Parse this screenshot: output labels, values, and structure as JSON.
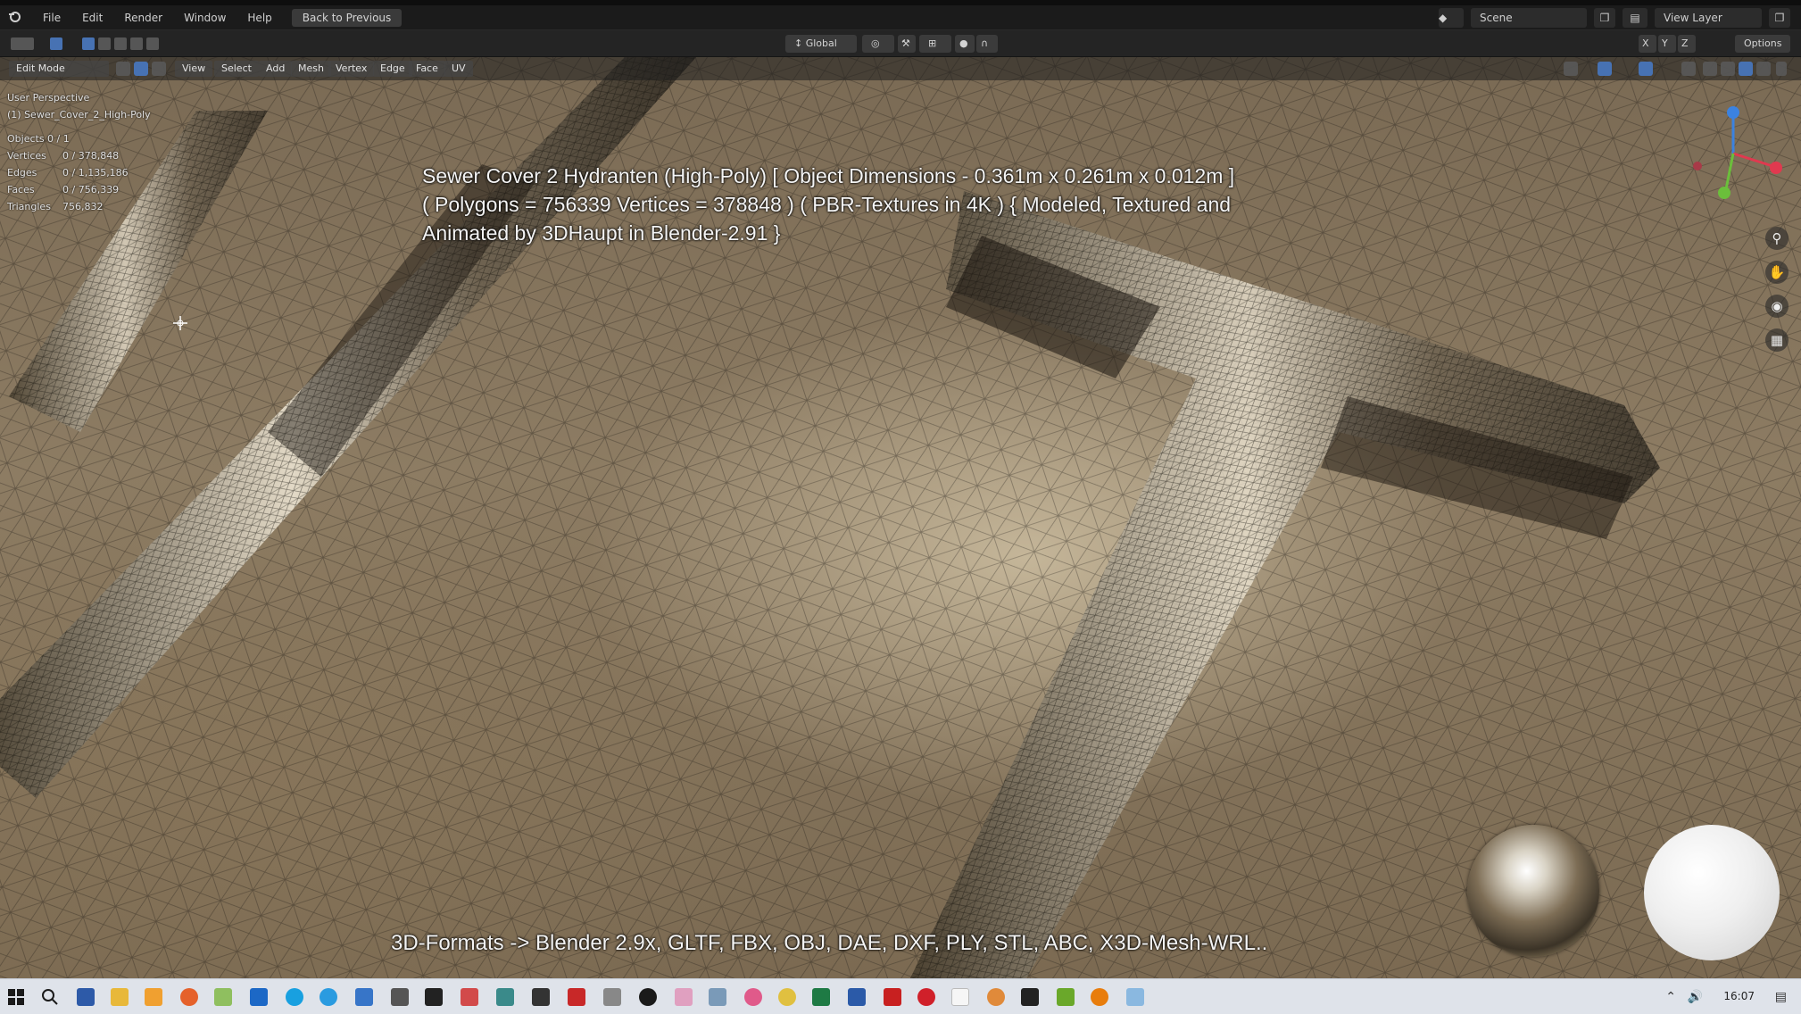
{
  "menubar": {
    "items": [
      "File",
      "Edit",
      "Render",
      "Window",
      "Help"
    ],
    "back_button": "Back to Previous",
    "scene_label": "Scene",
    "view_layer_label": "View Layer"
  },
  "header": {
    "transform_orientation": "Global",
    "options_label": "Options"
  },
  "viewport_header": {
    "mode": "Edit Mode",
    "menus": [
      "View",
      "Select",
      "Add",
      "Mesh",
      "Vertex",
      "Edge",
      "Face",
      "UV"
    ]
  },
  "overlay": {
    "perspective": "User Perspective",
    "object_name": "(1) Sewer_Cover_2_High-Poly",
    "objects": "Objects  0 / 1",
    "stats": [
      {
        "label": "Vertices",
        "value": "0 / 378,848"
      },
      {
        "label": "Edges",
        "value": "0 / 1,135,186"
      },
      {
        "label": "Faces",
        "value": "0 / 756,339"
      },
      {
        "label": "Triangles",
        "value": "756,832"
      }
    ]
  },
  "caption": {
    "line1": "Sewer Cover 2 Hydranten (High-Poly) [ Object Dimensions -  0.361m x 0.261m x 0.012m ]",
    "line2": "( Polygons = 756339 Vertices = 378848 ) ( PBR-Textures in 4K ) { Modeled, Textured and",
    "line3": "Animated by 3DHaupt in Blender-2.91 }"
  },
  "formats": "3D-Formats -> Blender 2.9x, GLTF, FBX, OBJ, DAE, DXF, PLY, STL, ABC, X3D-Mesh-WRL..",
  "taskbar": {
    "clock": "16:07"
  },
  "colors": {
    "ui_dark": "#1b1b1b",
    "ui_header": "#242424",
    "taskbar": "#dfe3ea",
    "axis_x": "#e0394f",
    "axis_y": "#6bbf3b",
    "axis_z": "#3b82e0"
  }
}
